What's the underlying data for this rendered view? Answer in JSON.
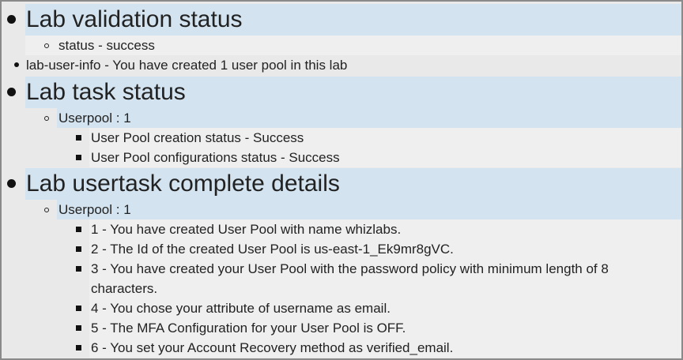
{
  "validation": {
    "heading": "Lab validation status",
    "status_line": "status - success"
  },
  "user_info": {
    "line": "lab-user-info - You have created 1 user pool in this lab"
  },
  "task_status": {
    "heading": "Lab task status",
    "userpool_label": "Userpool : 1",
    "items": [
      "User Pool creation status - Success",
      "User Pool configurations status - Success"
    ]
  },
  "usertask": {
    "heading": "Lab usertask complete details",
    "userpool_label": "Userpool : 1",
    "items": [
      "1 - You have created User Pool with name whizlabs.",
      "2 - The Id of the created User Pool is us-east-1_Ek9mr8gVC.",
      "3 - You have created your User Pool with the password policy with minimum length of 8",
      "characters.",
      "4 - You chose your attribute of username as email.",
      "5 - The MFA Configuration for your User Pool is OFF.",
      "6 - You set your Account Recovery method as verified_email."
    ]
  }
}
